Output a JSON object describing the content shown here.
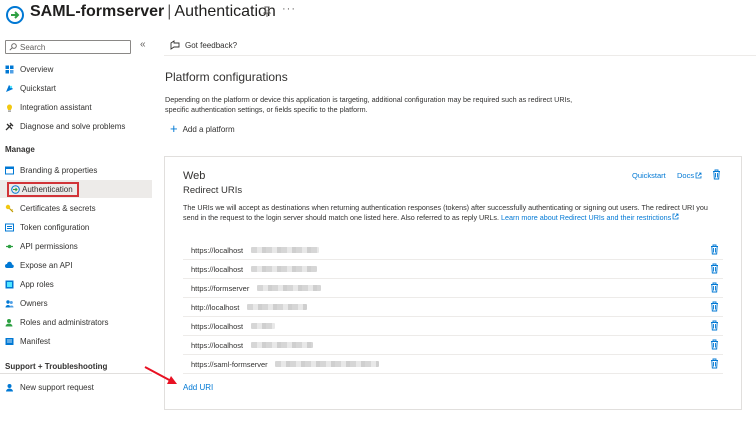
{
  "header": {
    "app_name": "SAML-formserver",
    "separator": "|",
    "page_name": "Authentication",
    "more": "···"
  },
  "sidebar": {
    "search_placeholder": "Search",
    "collapse": "«",
    "items_top": [
      {
        "label": "Overview",
        "icon": "overview-icon"
      },
      {
        "label": "Quickstart",
        "icon": "quickstart-icon"
      },
      {
        "label": "Integration assistant",
        "icon": "integration-assistant-icon"
      },
      {
        "label": "Diagnose and solve problems",
        "icon": "diagnose-icon"
      }
    ],
    "section_manage": "Manage",
    "items_manage": [
      {
        "label": "Branding & properties",
        "icon": "branding-icon"
      },
      {
        "label": "Authentication",
        "icon": "authentication-icon",
        "active": true
      },
      {
        "label": "Certificates & secrets",
        "icon": "key-icon"
      },
      {
        "label": "Token configuration",
        "icon": "token-icon"
      },
      {
        "label": "API permissions",
        "icon": "api-permissions-icon"
      },
      {
        "label": "Expose an API",
        "icon": "cloud-icon"
      },
      {
        "label": "App roles",
        "icon": "app-roles-icon"
      },
      {
        "label": "Owners",
        "icon": "owners-icon"
      },
      {
        "label": "Roles and administrators",
        "icon": "roles-icon"
      },
      {
        "label": "Manifest",
        "icon": "manifest-icon"
      }
    ],
    "section_support": "Support + Troubleshooting",
    "items_support": [
      {
        "label": "New support request",
        "icon": "support-icon"
      }
    ]
  },
  "cmdbar": {
    "feedback_label": "Got feedback?"
  },
  "main": {
    "title": "Platform configurations",
    "description": "Depending on the platform or device this application is targeting, additional configuration may be required such as redirect URIs, specific authentication settings, or fields specific to the platform.",
    "add_platform": "Add a platform"
  },
  "web_card": {
    "title": "Web",
    "subtitle": "Redirect URIs",
    "quickstart": "Quickstart",
    "docs": "Docs",
    "description": "The URIs we will accept as destinations when returning authentication responses (tokens) after successfully authenticating or signing out users. The redirect URI you send in the request to the login server should match one listed here. Also referred to as reply URLs.",
    "learn_more": "Learn more about Redirect URIs and their restrictions",
    "uris": [
      "https://localhost",
      "https://localhost",
      "https://formserver",
      "http://localhost",
      "https://localhost",
      "https://localhost",
      "https://saml-formserver"
    ],
    "add_uri": "Add URI"
  },
  "colors": {
    "accent": "#0078d4",
    "highlight_border": "#d13438",
    "active_bg": "#edebe9"
  }
}
